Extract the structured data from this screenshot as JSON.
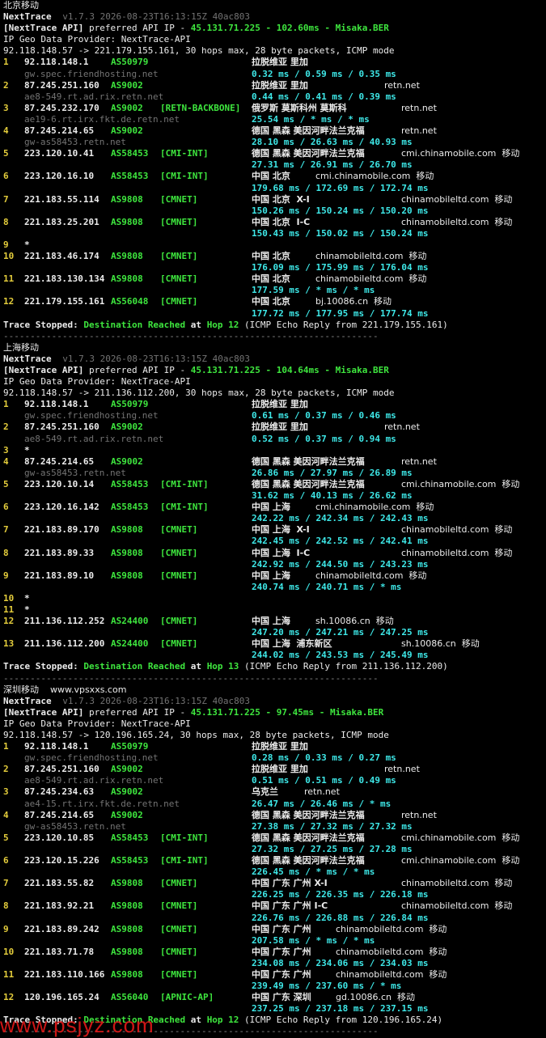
{
  "colors": {
    "hop_num": "#e4cd3c",
    "ip": "#ececec",
    "asn": "#3ee63e",
    "tag": "#3ee63e",
    "geo": "#ececec",
    "rdns": "#ececec",
    "latency": "#3ee8e8",
    "hostname": "#737373"
  },
  "watermark": "www.psjyz.com",
  "sections": [
    {
      "title": "北京移动",
      "nt_name": "NextTrace",
      "nt_version": "v1.7.3 2026-08-23T16:13:15Z 40ac803",
      "api_label": "[NextTrace API]",
      "api_text": " preferred API IP - ",
      "api_ip": "45.131.71.225",
      "api_sep1": " - ",
      "api_ms": "102.60ms",
      "api_sep2": " - ",
      "api_node": "Misaka.BER",
      "geo_provider": "IP Geo Data Provider: NextTrace-API",
      "route_line": "92.118.148.57 -> 221.179.155.161, 30 hops max, 28 byte packets, ICMP mode",
      "hops": [
        {
          "n": "1",
          "ip": "92.118.148.1",
          "asn": "AS50979",
          "tag": "",
          "geo": "拉脱维亚 里加",
          "rdns": "",
          "host": "gw.spec.friendhosting.net",
          "lat": "0.32 ms / 0.59 ms / 0.35 ms"
        },
        {
          "n": "2",
          "ip": "87.245.251.160",
          "asn": "AS9002",
          "tag": "",
          "geo": "拉脱维亚 里加",
          "rdns": "retn.net",
          "host": "ae8-549.rt.ad.rix.retn.net",
          "lat": "0.44 ms / 0.41 ms / 0.39 ms"
        },
        {
          "n": "3",
          "ip": "87.245.232.170",
          "asn": "AS9002",
          "tag": "[RETN-BACKBONE]",
          "geo": "俄罗斯 莫斯科州 莫斯科",
          "rdns": "retn.net",
          "host": "ae19-6.rt.irx.fkt.de.retn.net",
          "lat": "25.54 ms / * ms / * ms"
        },
        {
          "n": "4",
          "ip": "87.245.214.65",
          "asn": "AS9002",
          "tag": "",
          "geo": "德国 黑森 美因河畔法兰克福",
          "rdns": "retn.net",
          "host": "gw-as58453.retn.net",
          "lat": "28.10 ms / 26.63 ms / 40.93 ms"
        },
        {
          "n": "5",
          "ip": "223.120.10.41",
          "asn": "AS58453",
          "tag": "[CMI-INT]",
          "geo": "德国 黑森 美因河畔法兰克福",
          "rdns": "cmi.chinamobile.com  移动",
          "host": "",
          "lat": "27.31 ms / 26.91 ms / 26.70 ms"
        },
        {
          "n": "6",
          "ip": "223.120.16.10",
          "asn": "AS58453",
          "tag": "[CMI-INT]",
          "geo": "中国 北京",
          "rdns": "cmi.chinamobile.com  移动",
          "host": "",
          "lat": "179.68 ms / 172.69 ms / 172.74 ms"
        },
        {
          "n": "7",
          "ip": "221.183.55.114",
          "asn": "AS9808",
          "tag": "[CMNET]",
          "geo": "中国 北京  X-I",
          "rdns": "chinamobileltd.com  移动",
          "host": "",
          "lat": "150.26 ms / 150.24 ms / 150.20 ms"
        },
        {
          "n": "8",
          "ip": "221.183.25.201",
          "asn": "AS9808",
          "tag": "[CMNET]",
          "geo": "中国 北京  I-C",
          "rdns": "chinamobileltd.com  移动",
          "host": "",
          "lat": "150.43 ms / 150.02 ms / 150.24 ms"
        },
        {
          "n": "9",
          "ip": "*",
          "asn": "",
          "tag": "",
          "geo": "",
          "rdns": "",
          "host": "",
          "lat": ""
        },
        {
          "n": "10",
          "ip": "221.183.46.174",
          "asn": "AS9808",
          "tag": "[CMNET]",
          "geo": "中国 北京",
          "rdns": "chinamobileltd.com  移动",
          "host": "",
          "lat": "176.09 ms / 175.99 ms / 176.04 ms"
        },
        {
          "n": "11",
          "ip": "221.183.130.134",
          "asn": "AS9808",
          "tag": "[CMNET]",
          "geo": "中国 北京",
          "rdns": "chinamobileltd.com  移动",
          "host": "",
          "lat": "177.59 ms / * ms / * ms"
        },
        {
          "n": "12",
          "ip": "221.179.155.161",
          "asn": "AS56048",
          "tag": "[CMNET]",
          "geo": "中国 北京",
          "rdns": "bj.10086.cn  移动",
          "host": "",
          "lat": "177.72 ms / 177.95 ms / 177.74 ms"
        }
      ],
      "stop_a": "Trace Stopped: ",
      "stop_b": "Destination Reached",
      "stop_c": " at ",
      "stop_d": "Hop 12",
      "stop_e": " (ICMP Echo Reply from 221.179.155.161)",
      "separator": "----------------------------------------------------------------------"
    },
    {
      "title": "上海移动",
      "nt_name": "NextTrace",
      "nt_version": "v1.7.3 2026-08-23T16:13:15Z 40ac803",
      "api_label": "[NextTrace API]",
      "api_text": " preferred API IP - ",
      "api_ip": "45.131.71.225",
      "api_sep1": " - ",
      "api_ms": "104.64ms",
      "api_sep2": " - ",
      "api_node": "Misaka.BER",
      "geo_provider": "IP Geo Data Provider: NextTrace-API",
      "route_line": "92.118.148.57 -> 211.136.112.200, 30 hops max, 28 byte packets, ICMP mode",
      "hops": [
        {
          "n": "1",
          "ip": "92.118.148.1",
          "asn": "AS50979",
          "tag": "",
          "geo": "拉脱维亚 里加",
          "rdns": "",
          "host": "gw.spec.friendhosting.net",
          "lat": "0.61 ms / 0.37 ms / 0.46 ms"
        },
        {
          "n": "2",
          "ip": "87.245.251.160",
          "asn": "AS9002",
          "tag": "",
          "geo": "拉脱维亚 里加",
          "rdns": "retn.net",
          "host": "ae8-549.rt.ad.rix.retn.net",
          "lat": "0.52 ms / 0.37 ms / 0.94 ms"
        },
        {
          "n": "3",
          "ip": "*",
          "asn": "",
          "tag": "",
          "geo": "",
          "rdns": "",
          "host": "",
          "lat": ""
        },
        {
          "n": "4",
          "ip": "87.245.214.65",
          "asn": "AS9002",
          "tag": "",
          "geo": "德国 黑森 美因河畔法兰克福",
          "rdns": "retn.net",
          "host": "gw-as58453.retn.net",
          "lat": "26.86 ms / 27.97 ms / 26.89 ms"
        },
        {
          "n": "5",
          "ip": "223.120.10.14",
          "asn": "AS58453",
          "tag": "[CMI-INT]",
          "geo": "德国 黑森 美因河畔法兰克福",
          "rdns": "cmi.chinamobile.com  移动",
          "host": "",
          "lat": "31.62 ms / 40.13 ms / 26.62 ms"
        },
        {
          "n": "6",
          "ip": "223.120.16.142",
          "asn": "AS58453",
          "tag": "[CMI-INT]",
          "geo": "中国 上海",
          "rdns": "cmi.chinamobile.com  移动",
          "host": "",
          "lat": "242.22 ms / 242.34 ms / 242.43 ms"
        },
        {
          "n": "7",
          "ip": "221.183.89.170",
          "asn": "AS9808",
          "tag": "[CMNET]",
          "geo": "中国 上海  X-I",
          "rdns": "chinamobileltd.com  移动",
          "host": "",
          "lat": "242.45 ms / 242.52 ms / 242.41 ms"
        },
        {
          "n": "8",
          "ip": "221.183.89.33",
          "asn": "AS9808",
          "tag": "[CMNET]",
          "geo": "中国 上海  I-C",
          "rdns": "chinamobileltd.com  移动",
          "host": "",
          "lat": "242.92 ms / 244.50 ms / 243.23 ms"
        },
        {
          "n": "9",
          "ip": "221.183.89.10",
          "asn": "AS9808",
          "tag": "[CMNET]",
          "geo": "中国 上海",
          "rdns": "chinamobileltd.com  移动",
          "host": "",
          "lat": "240.74 ms / 240.71 ms / * ms"
        },
        {
          "n": "10",
          "ip": "*",
          "asn": "",
          "tag": "",
          "geo": "",
          "rdns": "",
          "host": "",
          "lat": ""
        },
        {
          "n": "11",
          "ip": "*",
          "asn": "",
          "tag": "",
          "geo": "",
          "rdns": "",
          "host": "",
          "lat": ""
        },
        {
          "n": "12",
          "ip": "211.136.112.252",
          "asn": "AS24400",
          "tag": "[CMNET]",
          "geo": "中国 上海",
          "rdns": "sh.10086.cn  移动",
          "host": "",
          "lat": "247.20 ms / 247.21 ms / 247.25 ms"
        },
        {
          "n": "13",
          "ip": "211.136.112.200",
          "asn": "AS24400",
          "tag": "[CMNET]",
          "geo": "中国 上海  浦东新区",
          "rdns": "sh.10086.cn  移动",
          "host": "",
          "lat": "244.02 ms / 243.53 ms / 245.49 ms"
        }
      ],
      "stop_a": "Trace Stopped: ",
      "stop_b": "Destination Reached",
      "stop_c": " at ",
      "stop_d": "Hop 13",
      "stop_e": " (ICMP Echo Reply from 211.136.112.200)",
      "separator": "----------------------------------------------------------------------"
    },
    {
      "title": "深圳移动    www.vpsxxs.com",
      "nt_name": "NextTrace",
      "nt_version": "v1.7.3 2026-08-23T16:13:15Z 40ac803",
      "api_label": "[NextTrace API]",
      "api_text": " preferred API IP - ",
      "api_ip": "45.131.71.225",
      "api_sep1": " - ",
      "api_ms": "97.45ms",
      "api_sep2": " - ",
      "api_node": "Misaka.BER",
      "geo_provider": "IP Geo Data Provider: NextTrace-API",
      "route_line": "92.118.148.57 -> 120.196.165.24, 30 hops max, 28 byte packets, ICMP mode",
      "hops": [
        {
          "n": "1",
          "ip": "92.118.148.1",
          "asn": "AS50979",
          "tag": "",
          "geo": "拉脱维亚 里加",
          "rdns": "",
          "host": "gw.spec.friendhosting.net",
          "lat": "0.28 ms / 0.33 ms / 0.27 ms"
        },
        {
          "n": "2",
          "ip": "87.245.251.160",
          "asn": "AS9002",
          "tag": "",
          "geo": "拉脱维亚 里加",
          "rdns": "retn.net",
          "host": "ae8-549.rt.ad.rix.retn.net",
          "lat": "0.51 ms / 0.51 ms / 0.49 ms"
        },
        {
          "n": "3",
          "ip": "87.245.234.63",
          "asn": "AS9002",
          "tag": "",
          "geo": "乌克兰",
          "rdns": "retn.net",
          "host": "ae4-15.rt.irx.fkt.de.retn.net",
          "lat": "26.47 ms / 26.46 ms / * ms"
        },
        {
          "n": "4",
          "ip": "87.245.214.65",
          "asn": "AS9002",
          "tag": "",
          "geo": "德国 黑森 美因河畔法兰克福",
          "rdns": "retn.net",
          "host": "gw-as58453.retn.net",
          "lat": "27.38 ms / 27.32 ms / 27.32 ms"
        },
        {
          "n": "5",
          "ip": "223.120.10.85",
          "asn": "AS58453",
          "tag": "[CMI-INT]",
          "geo": "德国 黑森 美因河畔法兰克福",
          "rdns": "cmi.chinamobile.com  移动",
          "host": "",
          "lat": "27.32 ms / 27.25 ms / 27.28 ms"
        },
        {
          "n": "6",
          "ip": "223.120.15.226",
          "asn": "AS58453",
          "tag": "[CMI-INT]",
          "geo": "德国 黑森 美因河畔法兰克福",
          "rdns": "cmi.chinamobile.com  移动",
          "host": "",
          "lat": "226.45 ms / * ms / * ms"
        },
        {
          "n": "7",
          "ip": "221.183.55.82",
          "asn": "AS9808",
          "tag": "[CMNET]",
          "geo": "中国 广东 广州 X-I",
          "rdns": "chinamobileltd.com  移动",
          "host": "",
          "lat": "226.25 ms / 226.35 ms / 226.18 ms"
        },
        {
          "n": "8",
          "ip": "221.183.92.21",
          "asn": "AS9808",
          "tag": "[CMNET]",
          "geo": "中国 广东 广州 I-C",
          "rdns": "chinamobileltd.com  移动",
          "host": "",
          "lat": "226.76 ms / 226.88 ms / 226.84 ms"
        },
        {
          "n": "9",
          "ip": "221.183.89.242",
          "asn": "AS9808",
          "tag": "[CMNET]",
          "geo": "中国 广东 广州",
          "rdns": "chinamobileltd.com  移动",
          "host": "",
          "lat": "207.58 ms / * ms / * ms"
        },
        {
          "n": "10",
          "ip": "221.183.71.78",
          "asn": "AS9808",
          "tag": "[CMNET]",
          "geo": "中国 广东 广州",
          "rdns": "chinamobileltd.com  移动",
          "host": "",
          "lat": "234.08 ms / 234.06 ms / 234.03 ms"
        },
        {
          "n": "11",
          "ip": "221.183.110.166",
          "asn": "AS9808",
          "tag": "[CMNET]",
          "geo": "中国 广东 广州",
          "rdns": "chinamobileltd.com  移动",
          "host": "",
          "lat": "239.49 ms / 237.60 ms / * ms"
        },
        {
          "n": "12",
          "ip": "120.196.165.24",
          "asn": "AS56040",
          "tag": "[APNIC-AP]",
          "geo": "中国 广东 深圳",
          "rdns": "gd.10086.cn  移动",
          "host": "",
          "lat": "237.25 ms / 237.18 ms / 237.15 ms"
        }
      ],
      "stop_a": "Trace Stopped: ",
      "stop_b": "Destination Reached",
      "stop_c": " at ",
      "stop_d": "Hop 12",
      "stop_e": " (ICMP Echo Reply from 120.196.165.24)",
      "separator": "----------------------------------------------------------------------"
    }
  ]
}
